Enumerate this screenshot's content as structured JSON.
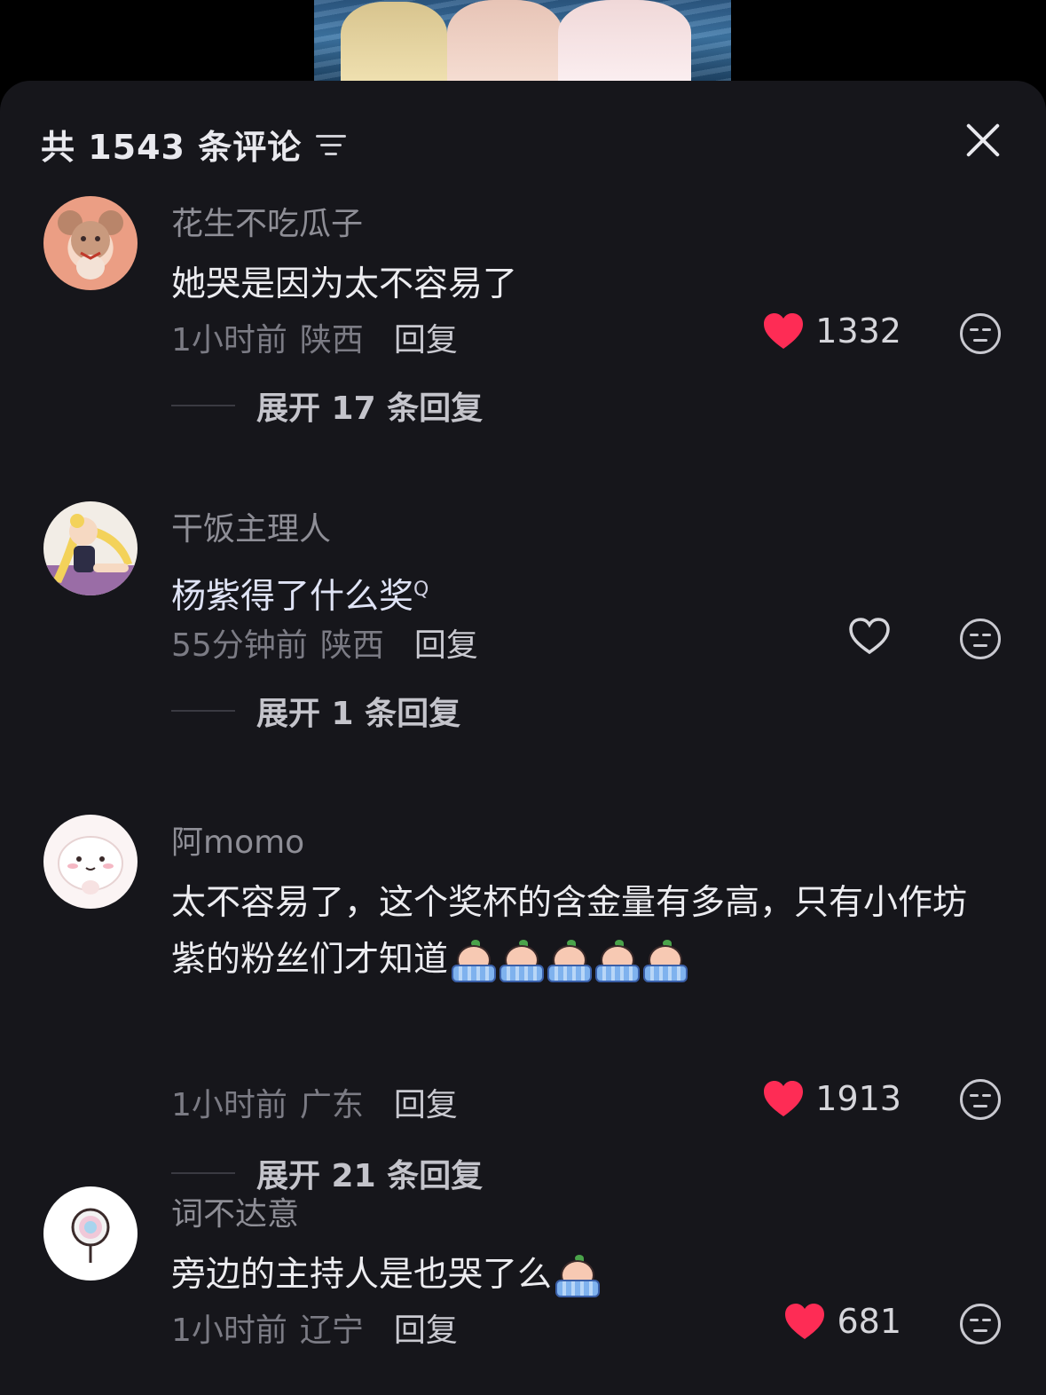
{
  "header": {
    "comment_count_label": "共 1543 条评论"
  },
  "comments": [
    {
      "username": "花生不吃瓜子",
      "text": "她哭是因为太不容易了",
      "time": "1小时前",
      "location": "陕西",
      "reply_label": "回复",
      "likes": "1332",
      "liked": true,
      "expand_label": "展开 17 条回复"
    },
    {
      "username": "干饭主理人",
      "text": "杨紫得了什么奖",
      "search_glyph": "Q",
      "time": "55分钟前",
      "location": "陕西",
      "reply_label": "回复",
      "likes": "",
      "liked": false,
      "expand_label": "展开 1 条回复"
    },
    {
      "username": "阿momo",
      "text": "太不容易了，这个奖杯的含金量有多高，只有小作坊紫的粉丝们才知道",
      "time": "1小时前",
      "location": "广东",
      "reply_label": "回复",
      "likes": "1913",
      "liked": true,
      "emoji": "crying-face-emoji",
      "emoji_count": 5,
      "expand_label": "展开 21 条回复"
    },
    {
      "username": "词不达意",
      "text": "旁边的主持人是也哭了么",
      "time": "1小时前",
      "location": "辽宁",
      "reply_label": "回复",
      "likes": "681",
      "liked": true,
      "emoji": "crying-face-emoji",
      "emoji_count": 1
    }
  ],
  "colors": {
    "sheet_bg": "#16161b",
    "heart_red": "#fe2c55",
    "username_gray": "#8e8e96"
  }
}
